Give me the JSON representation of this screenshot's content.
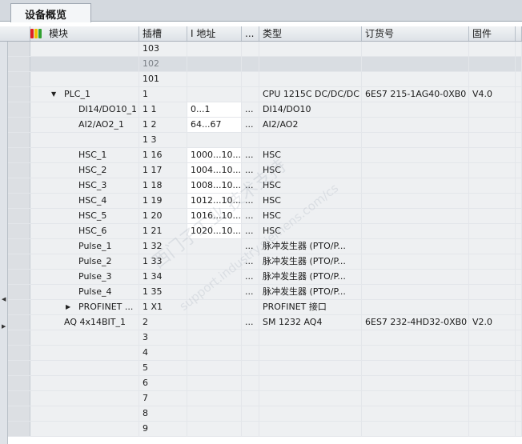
{
  "tab": {
    "label": "设备概览"
  },
  "columns": {
    "module": "模块",
    "slot": "插槽",
    "i_address": "I 地址",
    "q_address": "...",
    "type": "类型",
    "order_no": "订货号",
    "firmware": "固件",
    "extra": ""
  },
  "rows": [
    {
      "module": "",
      "slot": "103",
      "i_addr": "",
      "q_addr": "",
      "type": "",
      "order_no": "",
      "firmware": ""
    },
    {
      "module": "",
      "slot": "102",
      "i_addr": "",
      "q_addr": "",
      "type": "",
      "order_no": "",
      "firmware": ""
    },
    {
      "module": "",
      "slot": "101",
      "i_addr": "",
      "q_addr": "",
      "type": "",
      "order_no": "",
      "firmware": ""
    },
    {
      "module": "PLC_1",
      "slot": "1",
      "i_addr": "",
      "q_addr": "",
      "type": "CPU 1215C DC/DC/DC",
      "order_no": "6ES7 215-1AG40-0XB0",
      "firmware": "V4.0"
    },
    {
      "module": "DI14/DO10_1",
      "slot": "1 1",
      "i_addr": "0...1",
      "q_addr": "...",
      "type": "DI14/DO10",
      "order_no": "",
      "firmware": ""
    },
    {
      "module": "AI2/AO2_1",
      "slot": "1 2",
      "i_addr": "64...67",
      "q_addr": "...",
      "type": "AI2/AO2",
      "order_no": "",
      "firmware": ""
    },
    {
      "module": "",
      "slot": "1 3",
      "i_addr": "",
      "q_addr": "",
      "type": "",
      "order_no": "",
      "firmware": ""
    },
    {
      "module": "HSC_1",
      "slot": "1 16",
      "i_addr": "1000...10...",
      "q_addr": "...",
      "type": "HSC",
      "order_no": "",
      "firmware": ""
    },
    {
      "module": "HSC_2",
      "slot": "1 17",
      "i_addr": "1004...10...",
      "q_addr": "...",
      "type": "HSC",
      "order_no": "",
      "firmware": ""
    },
    {
      "module": "HSC_3",
      "slot": "1 18",
      "i_addr": "1008...10...",
      "q_addr": "...",
      "type": "HSC",
      "order_no": "",
      "firmware": ""
    },
    {
      "module": "HSC_4",
      "slot": "1 19",
      "i_addr": "1012...10...",
      "q_addr": "...",
      "type": "HSC",
      "order_no": "",
      "firmware": ""
    },
    {
      "module": "HSC_5",
      "slot": "1 20",
      "i_addr": "1016...10...",
      "q_addr": "...",
      "type": "HSC",
      "order_no": "",
      "firmware": ""
    },
    {
      "module": "HSC_6",
      "slot": "1 21",
      "i_addr": "1020...10...",
      "q_addr": "...",
      "type": "HSC",
      "order_no": "",
      "firmware": ""
    },
    {
      "module": "Pulse_1",
      "slot": "1 32",
      "i_addr": "",
      "q_addr": "...",
      "type": "脉冲发生器 (PTO/P...",
      "order_no": "",
      "firmware": ""
    },
    {
      "module": "Pulse_2",
      "slot": "1 33",
      "i_addr": "",
      "q_addr": "...",
      "type": "脉冲发生器 (PTO/P...",
      "order_no": "",
      "firmware": ""
    },
    {
      "module": "Pulse_3",
      "slot": "1 34",
      "i_addr": "",
      "q_addr": "...",
      "type": "脉冲发生器 (PTO/P...",
      "order_no": "",
      "firmware": ""
    },
    {
      "module": "Pulse_4",
      "slot": "1 35",
      "i_addr": "",
      "q_addr": "...",
      "type": "脉冲发生器 (PTO/P...",
      "order_no": "",
      "firmware": ""
    },
    {
      "module": "PROFINET ...",
      "slot": "1 X1",
      "i_addr": "",
      "q_addr": "",
      "type": "PROFINET 接口",
      "order_no": "",
      "firmware": ""
    },
    {
      "module": "AQ 4x14BIT_1",
      "slot": "2",
      "i_addr": "",
      "q_addr": "...",
      "type": "SM 1232 AQ4",
      "order_no": "6ES7 232-4HD32-0XB0",
      "firmware": "V2.0"
    },
    {
      "module": "",
      "slot": "3",
      "i_addr": "",
      "q_addr": "",
      "type": "",
      "order_no": "",
      "firmware": ""
    },
    {
      "module": "",
      "slot": "4",
      "i_addr": "",
      "q_addr": "",
      "type": "",
      "order_no": "",
      "firmware": ""
    },
    {
      "module": "",
      "slot": "5",
      "i_addr": "",
      "q_addr": "",
      "type": "",
      "order_no": "",
      "firmware": ""
    },
    {
      "module": "",
      "slot": "6",
      "i_addr": "",
      "q_addr": "",
      "type": "",
      "order_no": "",
      "firmware": ""
    },
    {
      "module": "",
      "slot": "7",
      "i_addr": "",
      "q_addr": "",
      "type": "",
      "order_no": "",
      "firmware": ""
    },
    {
      "module": "",
      "slot": "8",
      "i_addr": "",
      "q_addr": "",
      "type": "",
      "order_no": "",
      "firmware": ""
    },
    {
      "module": "",
      "slot": "9",
      "i_addr": "",
      "q_addr": "",
      "type": "",
      "order_no": "",
      "firmware": ""
    }
  ],
  "watermark": {
    "line1": "西门子工业 技术支持",
    "line2": "support.industry.siemens.com/cs"
  },
  "colors": {
    "header_bg": "#e6e9ed",
    "selected_row": "#d9dde2",
    "flag_red": "#e02020",
    "flag_yellow": "#f0c000",
    "flag_green": "#30a030"
  },
  "icons": {
    "filter_flag": "colored-flags-icon",
    "expand_open": "triangle-down-icon",
    "expand_closed": "triangle-right-icon"
  }
}
